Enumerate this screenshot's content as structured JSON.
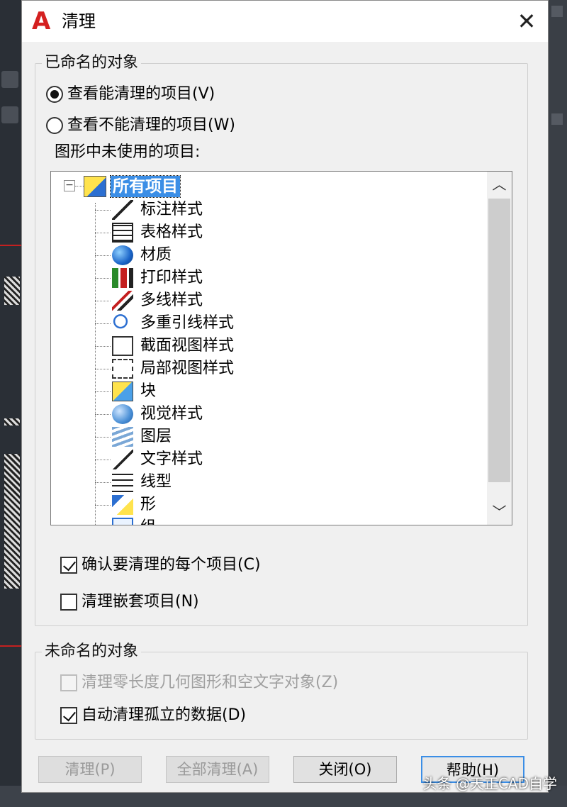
{
  "dialog": {
    "title": "清理",
    "app_logo_text": "A"
  },
  "named_objects": {
    "legend": "已命名的对象",
    "radio_view_purgeable": "查看能清理的项目(V)",
    "radio_view_nonpurgeable": "查看不能清理的项目(W)",
    "selected_radio": "view_purgeable",
    "tree_label": "图形中未使用的项目:",
    "tree": {
      "root": "所有项目",
      "items": [
        {
          "label": "标注样式",
          "icon": "dimension-style-icon"
        },
        {
          "label": "表格样式",
          "icon": "table-style-icon"
        },
        {
          "label": "材质",
          "icon": "material-icon"
        },
        {
          "label": "打印样式",
          "icon": "plot-style-icon"
        },
        {
          "label": "多线样式",
          "icon": "multiline-style-icon"
        },
        {
          "label": "多重引线样式",
          "icon": "multileader-style-icon"
        },
        {
          "label": "截面视图样式",
          "icon": "section-view-style-icon"
        },
        {
          "label": "局部视图样式",
          "icon": "detail-view-style-icon"
        },
        {
          "label": "块",
          "icon": "block-icon"
        },
        {
          "label": "视觉样式",
          "icon": "visual-style-icon"
        },
        {
          "label": "图层",
          "icon": "layer-icon"
        },
        {
          "label": "文字样式",
          "icon": "text-style-icon"
        },
        {
          "label": "线型",
          "icon": "linetype-icon"
        },
        {
          "label": "形",
          "icon": "shape-icon"
        },
        {
          "label": "组",
          "icon": "group-icon"
        }
      ]
    },
    "check_confirm_each": "确认要清理的每个项目(C)",
    "check_confirm_each_checked": true,
    "check_nested": "清理嵌套项目(N)",
    "check_nested_checked": false
  },
  "unnamed_objects": {
    "legend": "未命名的对象",
    "check_zero_length": "清理零长度几何图形和空文字对象(Z)",
    "check_zero_length_enabled": false,
    "check_orphaned": "自动清理孤立的数据(D)",
    "check_orphaned_checked": true
  },
  "buttons": {
    "purge": "清理(P)",
    "purge_all": "全部清理(A)",
    "close": "关闭(O)",
    "help": "帮助(H)"
  },
  "watermark": "头条 @天正CAD自学",
  "colors": {
    "selection": "#3b8ee6",
    "logo_red": "#d42020",
    "dialog_bg": "#f0f0f0"
  }
}
